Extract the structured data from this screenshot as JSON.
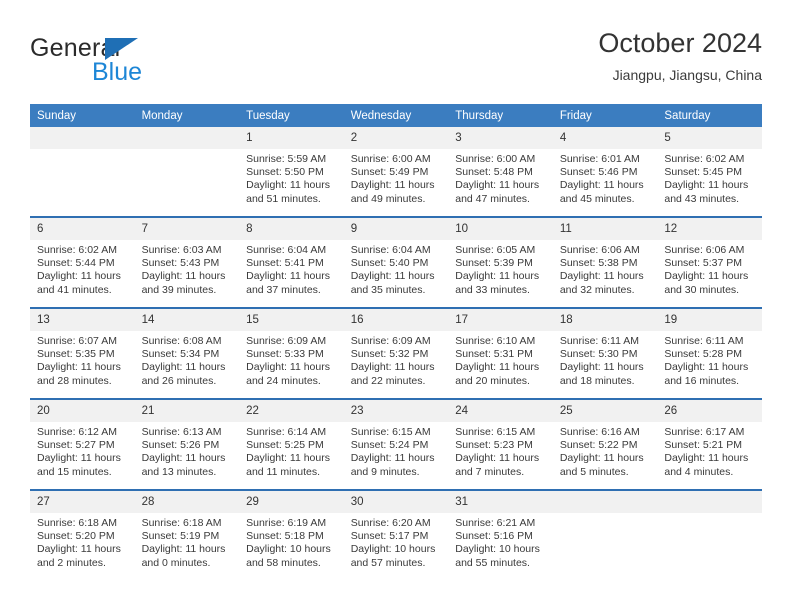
{
  "brand": {
    "name_top": "General",
    "name_bottom": "Blue",
    "accent_color": "#1d86d6",
    "triangle_color": "#1f6fb5"
  },
  "header": {
    "title": "October 2024",
    "subtitle": "Jiangpu, Jiangsu, China"
  },
  "theme": {
    "header_row_bg": "#3b7dc0",
    "row_divider": "#2f6fb2",
    "daynum_bg": "#f1f1f1",
    "text": "#333333"
  },
  "weekdays": [
    "Sunday",
    "Monday",
    "Tuesday",
    "Wednesday",
    "Thursday",
    "Friday",
    "Saturday"
  ],
  "labels": {
    "sunrise_prefix": "Sunrise:",
    "sunset_prefix": "Sunset:",
    "daylight_prefix": "Daylight:"
  },
  "weeks": [
    [
      {
        "day": "",
        "empty": true
      },
      {
        "day": "",
        "empty": true
      },
      {
        "day": "1",
        "sunrise": "Sunrise: 5:59 AM",
        "sunset": "Sunset: 5:50 PM",
        "daylight_1": "Daylight: 11 hours",
        "daylight_2": "and 51 minutes."
      },
      {
        "day": "2",
        "sunrise": "Sunrise: 6:00 AM",
        "sunset": "Sunset: 5:49 PM",
        "daylight_1": "Daylight: 11 hours",
        "daylight_2": "and 49 minutes."
      },
      {
        "day": "3",
        "sunrise": "Sunrise: 6:00 AM",
        "sunset": "Sunset: 5:48 PM",
        "daylight_1": "Daylight: 11 hours",
        "daylight_2": "and 47 minutes."
      },
      {
        "day": "4",
        "sunrise": "Sunrise: 6:01 AM",
        "sunset": "Sunset: 5:46 PM",
        "daylight_1": "Daylight: 11 hours",
        "daylight_2": "and 45 minutes."
      },
      {
        "day": "5",
        "sunrise": "Sunrise: 6:02 AM",
        "sunset": "Sunset: 5:45 PM",
        "daylight_1": "Daylight: 11 hours",
        "daylight_2": "and 43 minutes."
      }
    ],
    [
      {
        "day": "6",
        "sunrise": "Sunrise: 6:02 AM",
        "sunset": "Sunset: 5:44 PM",
        "daylight_1": "Daylight: 11 hours",
        "daylight_2": "and 41 minutes."
      },
      {
        "day": "7",
        "sunrise": "Sunrise: 6:03 AM",
        "sunset": "Sunset: 5:43 PM",
        "daylight_1": "Daylight: 11 hours",
        "daylight_2": "and 39 minutes."
      },
      {
        "day": "8",
        "sunrise": "Sunrise: 6:04 AM",
        "sunset": "Sunset: 5:41 PM",
        "daylight_1": "Daylight: 11 hours",
        "daylight_2": "and 37 minutes."
      },
      {
        "day": "9",
        "sunrise": "Sunrise: 6:04 AM",
        "sunset": "Sunset: 5:40 PM",
        "daylight_1": "Daylight: 11 hours",
        "daylight_2": "and 35 minutes."
      },
      {
        "day": "10",
        "sunrise": "Sunrise: 6:05 AM",
        "sunset": "Sunset: 5:39 PM",
        "daylight_1": "Daylight: 11 hours",
        "daylight_2": "and 33 minutes."
      },
      {
        "day": "11",
        "sunrise": "Sunrise: 6:06 AM",
        "sunset": "Sunset: 5:38 PM",
        "daylight_1": "Daylight: 11 hours",
        "daylight_2": "and 32 minutes."
      },
      {
        "day": "12",
        "sunrise": "Sunrise: 6:06 AM",
        "sunset": "Sunset: 5:37 PM",
        "daylight_1": "Daylight: 11 hours",
        "daylight_2": "and 30 minutes."
      }
    ],
    [
      {
        "day": "13",
        "sunrise": "Sunrise: 6:07 AM",
        "sunset": "Sunset: 5:35 PM",
        "daylight_1": "Daylight: 11 hours",
        "daylight_2": "and 28 minutes."
      },
      {
        "day": "14",
        "sunrise": "Sunrise: 6:08 AM",
        "sunset": "Sunset: 5:34 PM",
        "daylight_1": "Daylight: 11 hours",
        "daylight_2": "and 26 minutes."
      },
      {
        "day": "15",
        "sunrise": "Sunrise: 6:09 AM",
        "sunset": "Sunset: 5:33 PM",
        "daylight_1": "Daylight: 11 hours",
        "daylight_2": "and 24 minutes."
      },
      {
        "day": "16",
        "sunrise": "Sunrise: 6:09 AM",
        "sunset": "Sunset: 5:32 PM",
        "daylight_1": "Daylight: 11 hours",
        "daylight_2": "and 22 minutes."
      },
      {
        "day": "17",
        "sunrise": "Sunrise: 6:10 AM",
        "sunset": "Sunset: 5:31 PM",
        "daylight_1": "Daylight: 11 hours",
        "daylight_2": "and 20 minutes."
      },
      {
        "day": "18",
        "sunrise": "Sunrise: 6:11 AM",
        "sunset": "Sunset: 5:30 PM",
        "daylight_1": "Daylight: 11 hours",
        "daylight_2": "and 18 minutes."
      },
      {
        "day": "19",
        "sunrise": "Sunrise: 6:11 AM",
        "sunset": "Sunset: 5:28 PM",
        "daylight_1": "Daylight: 11 hours",
        "daylight_2": "and 16 minutes."
      }
    ],
    [
      {
        "day": "20",
        "sunrise": "Sunrise: 6:12 AM",
        "sunset": "Sunset: 5:27 PM",
        "daylight_1": "Daylight: 11 hours",
        "daylight_2": "and 15 minutes."
      },
      {
        "day": "21",
        "sunrise": "Sunrise: 6:13 AM",
        "sunset": "Sunset: 5:26 PM",
        "daylight_1": "Daylight: 11 hours",
        "daylight_2": "and 13 minutes."
      },
      {
        "day": "22",
        "sunrise": "Sunrise: 6:14 AM",
        "sunset": "Sunset: 5:25 PM",
        "daylight_1": "Daylight: 11 hours",
        "daylight_2": "and 11 minutes."
      },
      {
        "day": "23",
        "sunrise": "Sunrise: 6:15 AM",
        "sunset": "Sunset: 5:24 PM",
        "daylight_1": "Daylight: 11 hours",
        "daylight_2": "and 9 minutes."
      },
      {
        "day": "24",
        "sunrise": "Sunrise: 6:15 AM",
        "sunset": "Sunset: 5:23 PM",
        "daylight_1": "Daylight: 11 hours",
        "daylight_2": "and 7 minutes."
      },
      {
        "day": "25",
        "sunrise": "Sunrise: 6:16 AM",
        "sunset": "Sunset: 5:22 PM",
        "daylight_1": "Daylight: 11 hours",
        "daylight_2": "and 5 minutes."
      },
      {
        "day": "26",
        "sunrise": "Sunrise: 6:17 AM",
        "sunset": "Sunset: 5:21 PM",
        "daylight_1": "Daylight: 11 hours",
        "daylight_2": "and 4 minutes."
      }
    ],
    [
      {
        "day": "27",
        "sunrise": "Sunrise: 6:18 AM",
        "sunset": "Sunset: 5:20 PM",
        "daylight_1": "Daylight: 11 hours",
        "daylight_2": "and 2 minutes."
      },
      {
        "day": "28",
        "sunrise": "Sunrise: 6:18 AM",
        "sunset": "Sunset: 5:19 PM",
        "daylight_1": "Daylight: 11 hours",
        "daylight_2": "and 0 minutes."
      },
      {
        "day": "29",
        "sunrise": "Sunrise: 6:19 AM",
        "sunset": "Sunset: 5:18 PM",
        "daylight_1": "Daylight: 10 hours",
        "daylight_2": "and 58 minutes."
      },
      {
        "day": "30",
        "sunrise": "Sunrise: 6:20 AM",
        "sunset": "Sunset: 5:17 PM",
        "daylight_1": "Daylight: 10 hours",
        "daylight_2": "and 57 minutes."
      },
      {
        "day": "31",
        "sunrise": "Sunrise: 6:21 AM",
        "sunset": "Sunset: 5:16 PM",
        "daylight_1": "Daylight: 10 hours",
        "daylight_2": "and 55 minutes."
      },
      {
        "day": "",
        "empty": true
      },
      {
        "day": "",
        "empty": true
      }
    ]
  ]
}
